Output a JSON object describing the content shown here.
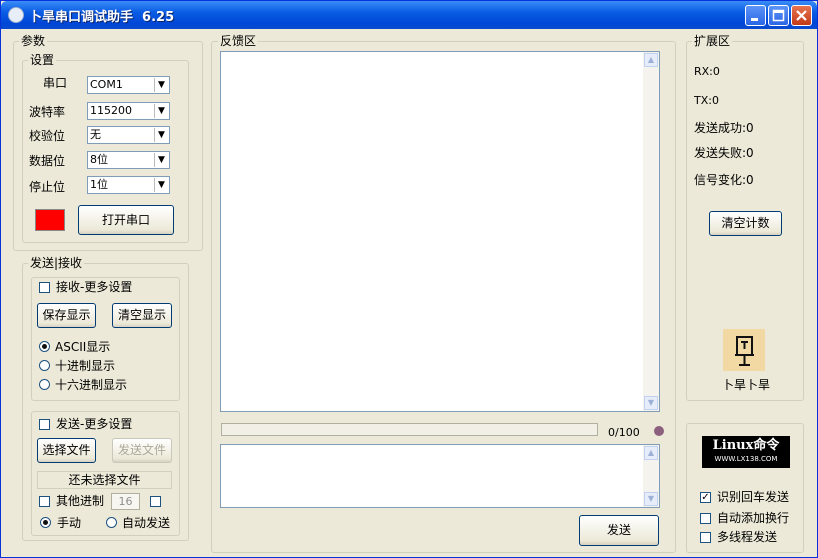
{
  "window": {
    "title": "卜旱串口调试助手  6.25"
  },
  "params": {
    "group_label": "参数",
    "settings_label": "设置",
    "port_label": "串口",
    "port_value": "COM1",
    "baud_label": "波特率",
    "baud_value": "115200",
    "parity_label": "校验位",
    "parity_value": "无",
    "databits_label": "数据位",
    "databits_value": "8位",
    "stopbits_label": "停止位",
    "stopbits_value": "1位",
    "status_color": "#ff0000",
    "open_button": "打开串口"
  },
  "sendrecv": {
    "group_label": "发送|接收",
    "recv_more_label": "接收-更多设置",
    "save_display_button": "保存显示",
    "clear_display_button": "清空显示",
    "radio_ascii": "ASCII显示",
    "radio_decimal": "十进制显示",
    "radio_hex": "十六进制显示",
    "send_more_label": "发送-更多设置",
    "choose_file_button": "选择文件",
    "send_file_button": "发送文件",
    "file_status": "还未选择文件",
    "other_radix_label": "其他进制",
    "other_radix_value": "16",
    "manual_label": "手动",
    "auto_send_label": "自动发送"
  },
  "feedback": {
    "label": "反馈区",
    "progress_text": "0/100",
    "progress": 0
  },
  "send": {
    "button": "发送"
  },
  "ext": {
    "label": "扩展区",
    "rx": "RX:0",
    "tx": "TX:0",
    "send_success": "发送成功:0",
    "send_fail": "发送失败:0",
    "signal_change": "信号变化:0",
    "clear_count_button": "清空计数",
    "logo_caption": "卜旱卜旱",
    "banner_main": "Linux命令",
    "banner_sub": "WWW.LX138.COM",
    "opt_cr_send": "识别回车发送",
    "opt_auto_newline": "自动添加换行",
    "opt_multithread": "多线程发送"
  }
}
